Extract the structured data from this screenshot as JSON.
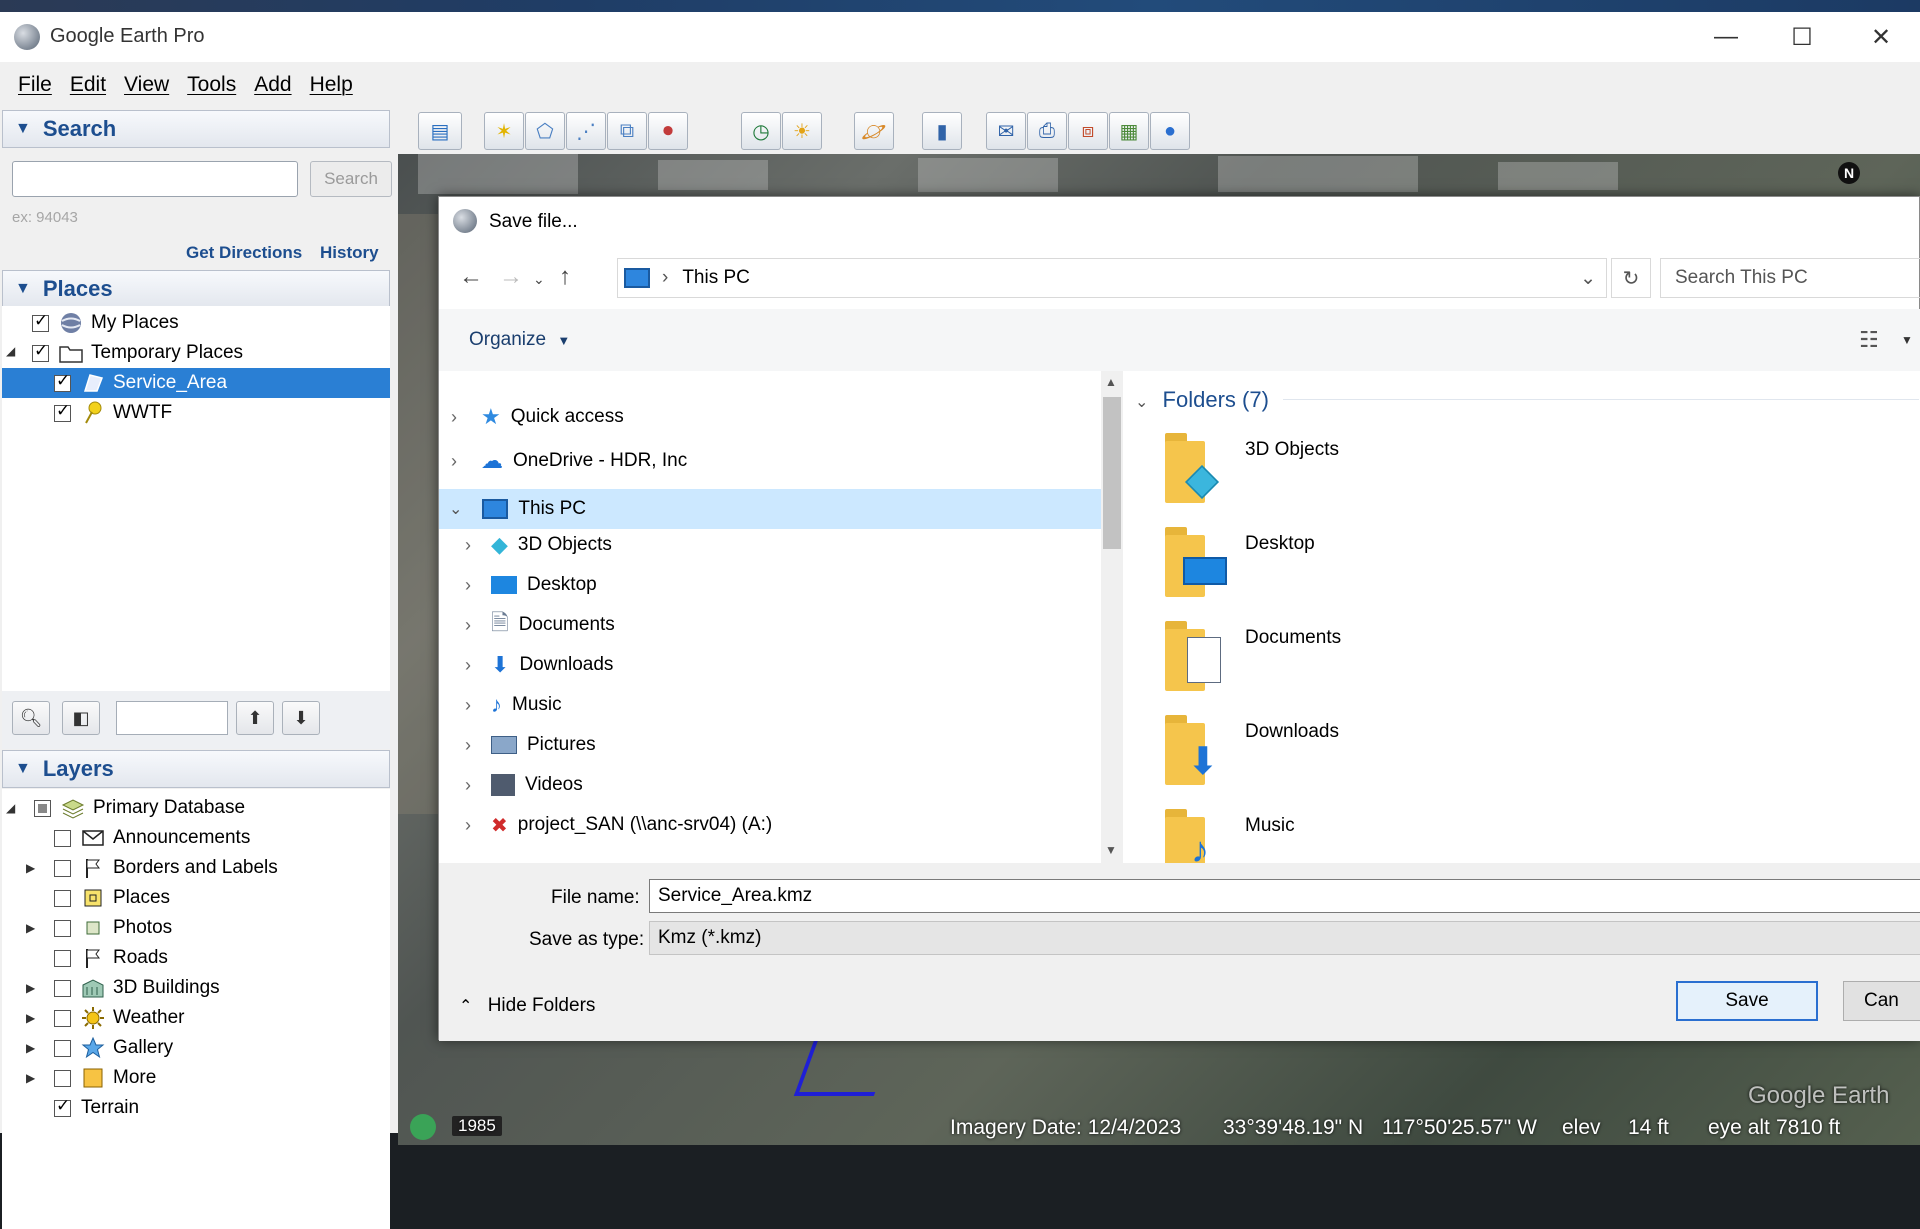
{
  "app": {
    "title": "Google Earth Pro"
  },
  "window_controls": {
    "minimize": "—",
    "maximize": "☐",
    "close": "✕"
  },
  "menu": [
    "File",
    "Edit",
    "View",
    "Tools",
    "Add",
    "Help"
  ],
  "search_panel": {
    "header": "Search",
    "button": "Search",
    "hint": "ex: 94043",
    "get_directions": "Get Directions",
    "history": "History"
  },
  "places_panel": {
    "header": "Places",
    "items": [
      {
        "label": "My Places",
        "checked": true,
        "icon": "globe-icon"
      },
      {
        "label": "Temporary Places",
        "checked": true,
        "icon": "folder-icon"
      },
      {
        "label": "Service_Area",
        "checked": true,
        "icon": "polygon-icon",
        "selected": true
      },
      {
        "label": "WWTF",
        "checked": true,
        "icon": "pushpin-icon"
      }
    ]
  },
  "layers_panel": {
    "header": "Layers",
    "items": [
      "Primary Database",
      "Announcements",
      "Borders and Labels",
      "Places",
      "Photos",
      "Roads",
      "3D Buildings",
      "Weather",
      "Gallery",
      "More",
      "Terrain"
    ]
  },
  "map": {
    "compass": "N",
    "year": "1985",
    "imagery_date": "Imagery Date: 12/4/2023",
    "lat": "33°39'48.19\" N",
    "lon": "117°50'25.57\" W",
    "elev_label": "elev",
    "elev": "14 ft",
    "eye_alt_label": "eye alt",
    "eye_alt": "7810 ft",
    "watermark": "Google Earth"
  },
  "dialog": {
    "title": "Save file...",
    "path": "This PC",
    "search_placeholder": "Search This PC",
    "organize": "Organize",
    "nav_items": {
      "quick_access": "Quick access",
      "onedrive": "OneDrive - HDR, Inc",
      "this_pc": "This PC",
      "objects3d": "3D Objects",
      "desktop": "Desktop",
      "documents": "Documents",
      "downloads": "Downloads",
      "music": "Music",
      "pictures": "Pictures",
      "videos": "Videos",
      "project": "project_SAN (\\\\anc-srv04) (A:)"
    },
    "folders_header": "Folders (7)",
    "folders": [
      "3D Objects",
      "Desktop",
      "Documents",
      "Downloads",
      "Music"
    ],
    "file_name_label": "File name:",
    "file_name": "Service_Area.kmz",
    "save_type_label": "Save as type:",
    "save_type": "Kmz (*.kmz)",
    "hide_folders": "Hide Folders",
    "save": "Save",
    "cancel": "Can"
  }
}
